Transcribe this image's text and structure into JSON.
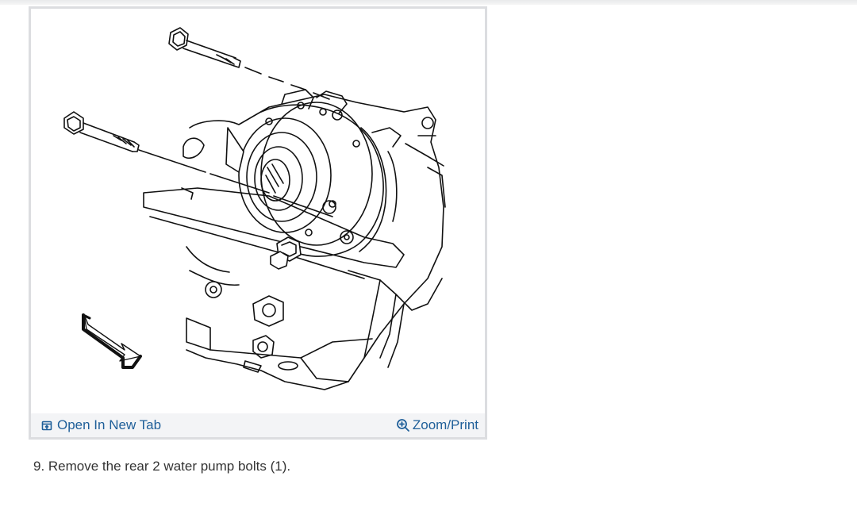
{
  "figure": {
    "open_tab_label": "Open In New Tab",
    "zoom_label": "Zoom/Print",
    "open_tab_icon": "open-in-new-tab-icon",
    "zoom_icon": "zoom-in-icon"
  },
  "instruction": {
    "step_text": "9. Remove the rear 2 water pump bolts (1)."
  },
  "colors": {
    "link": "#1f5f99",
    "footer_bg": "#f3f4f6",
    "card_border": "#dcdde0",
    "body_text": "#333333"
  }
}
